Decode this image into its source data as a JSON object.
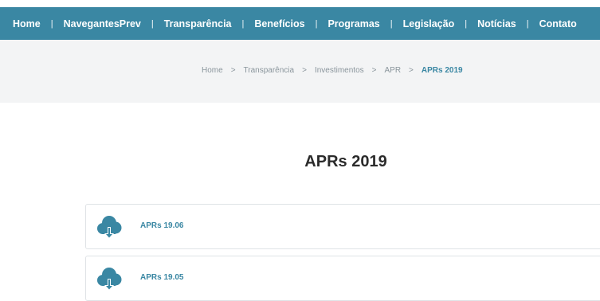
{
  "nav": {
    "items": [
      "Home",
      "NavegantesPrev",
      "Transparência",
      "Benefícios",
      "Programas",
      "Legislação",
      "Notícias",
      "Contato"
    ],
    "separator": "|",
    "color": "#3a87a3"
  },
  "breadcrumb": {
    "items": [
      "Home",
      "Transparência",
      "Investimentos",
      "APR"
    ],
    "current": "APRs 2019",
    "separator": ">"
  },
  "page": {
    "title": "APRs 2019"
  },
  "files": [
    {
      "label": "APRs 19.06",
      "icon": "cloud-download-icon"
    },
    {
      "label": "APRs 19.05",
      "icon": "cloud-download-icon"
    }
  ],
  "colors": {
    "accent": "#3a87a3",
    "breadcrumb_bg": "#f3f4f5",
    "title": "#2b2b2b"
  }
}
